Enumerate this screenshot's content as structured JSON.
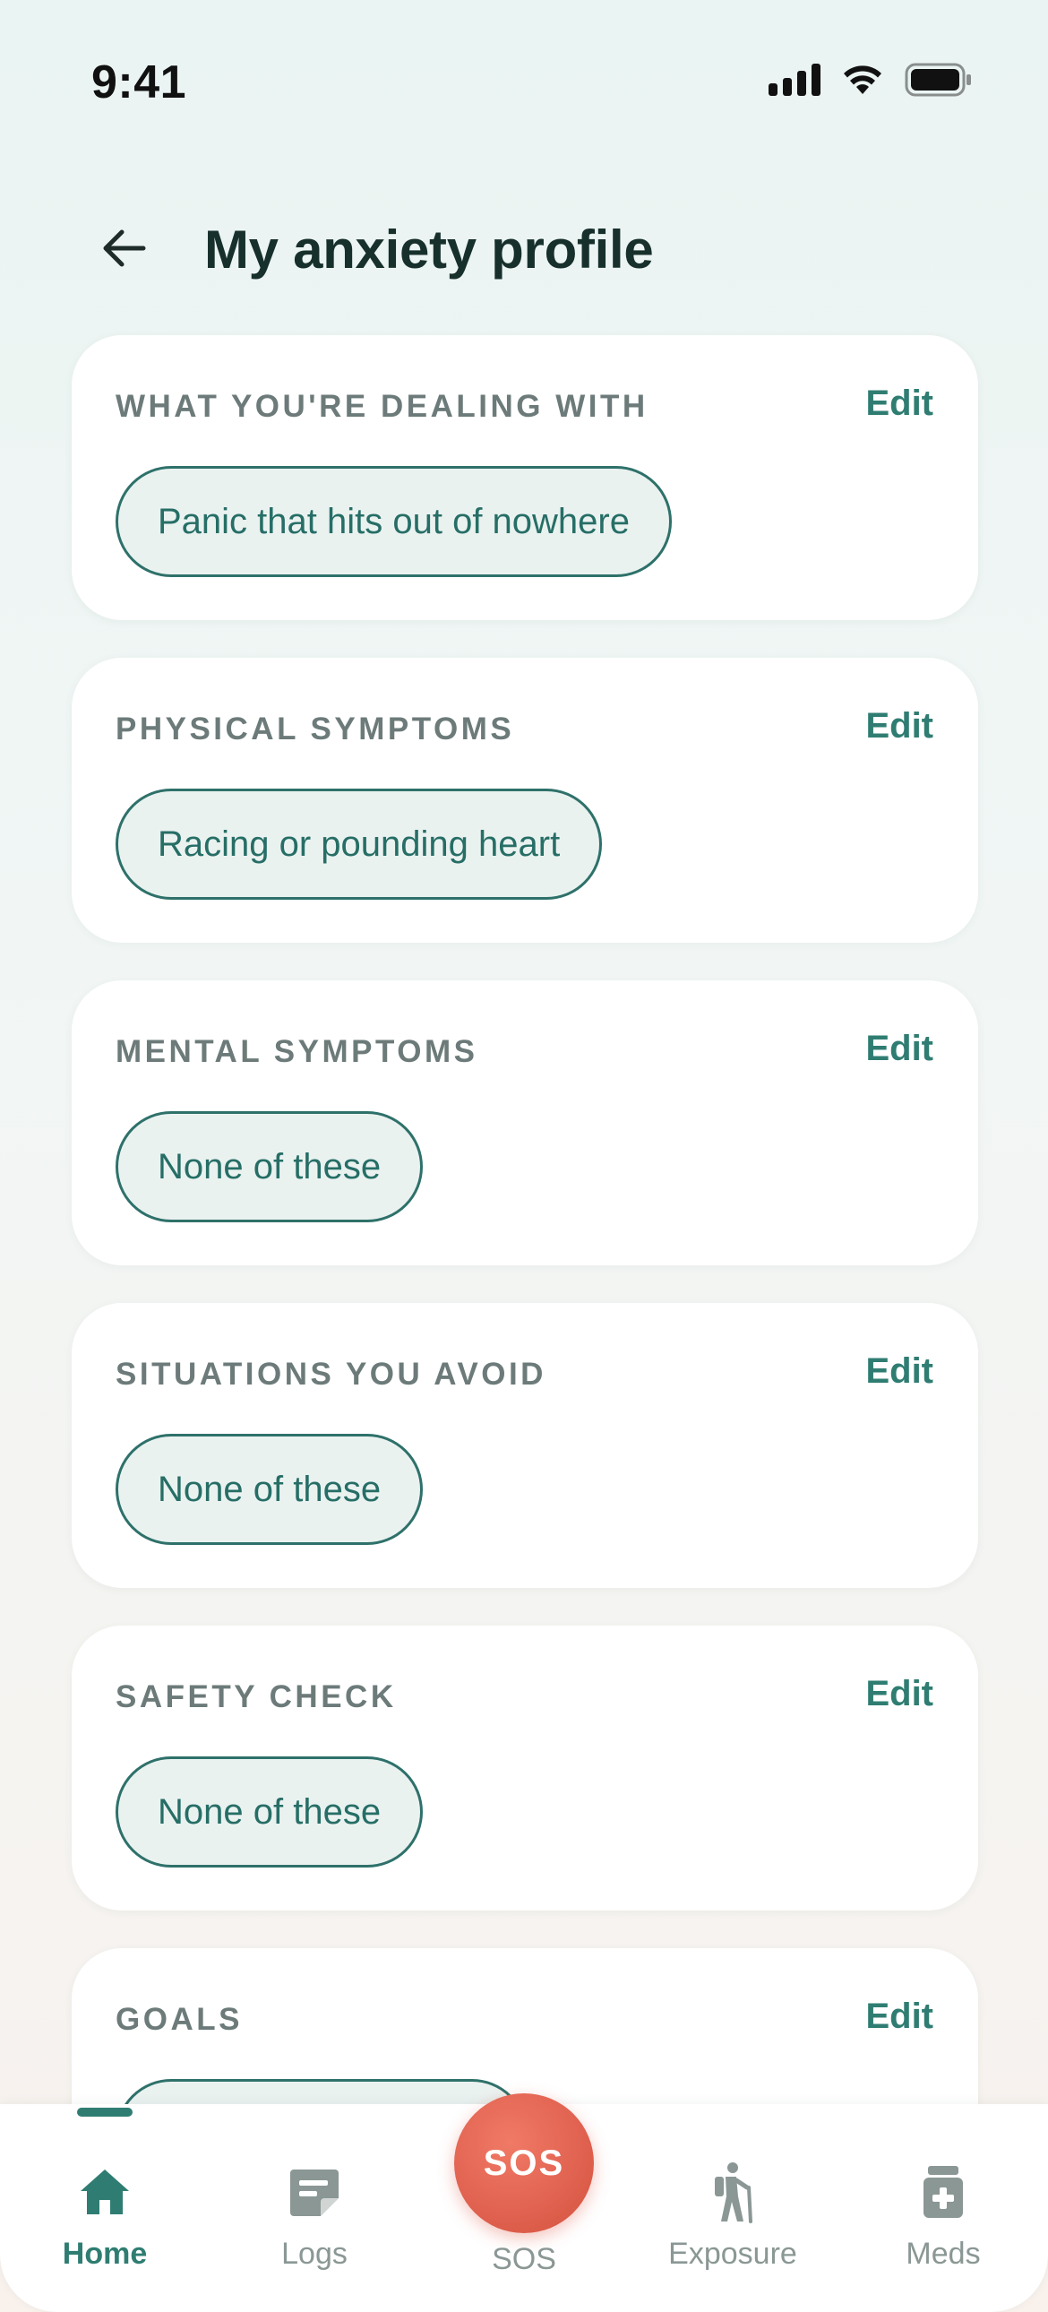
{
  "status_bar": {
    "time": "9:41"
  },
  "header": {
    "title": "My anxiety profile",
    "back_icon": "arrow-left-icon"
  },
  "colors": {
    "accent": "#2f7d72",
    "sos": "#e0614f",
    "chip_bg": "#eaf2f0"
  },
  "cards": [
    {
      "title": "WHAT YOU'RE DEALING WITH",
      "edit_label": "Edit",
      "chip": "Panic that hits out of nowhere"
    },
    {
      "title": "PHYSICAL SYMPTOMS",
      "edit_label": "Edit",
      "chip": "Racing or pounding heart"
    },
    {
      "title": "MENTAL SYMPTOMS",
      "edit_label": "Edit",
      "chip": "None of these"
    },
    {
      "title": "SITUATIONS YOU AVOID",
      "edit_label": "Edit",
      "chip": "None of these"
    },
    {
      "title": "SAFETY CHECK",
      "edit_label": "Edit",
      "chip": "None of these"
    },
    {
      "title": "GOALS",
      "edit_label": "Edit",
      "chip": ""
    }
  ],
  "nav": {
    "items": [
      {
        "label": "Home",
        "icon": "home-icon",
        "active": true
      },
      {
        "label": "Logs",
        "icon": "notes-icon",
        "active": false
      },
      {
        "label": "SOS",
        "icon": "sos-icon",
        "active": false
      },
      {
        "label": "Exposure",
        "icon": "hiker-icon",
        "active": false
      },
      {
        "label": "Meds",
        "icon": "medicine-icon",
        "active": false
      }
    ],
    "sos_button_text": "SOS"
  }
}
